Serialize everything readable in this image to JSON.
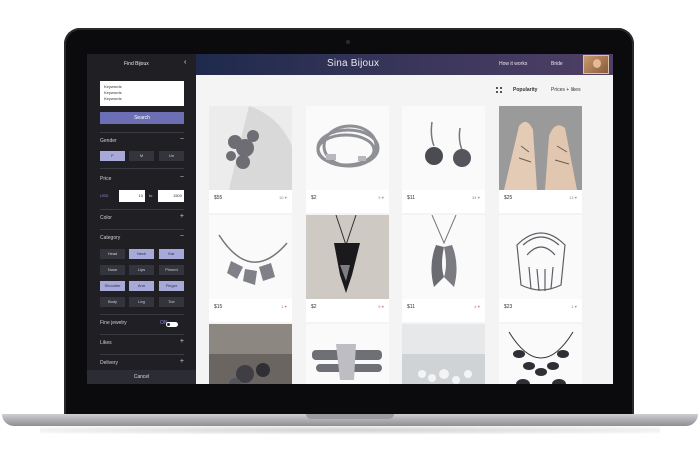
{
  "sidebar": {
    "title": "Find Bijoux",
    "close_icon": "chevron-left-icon",
    "keywords": [
      "Keywords",
      "Keywords",
      "Keywords"
    ],
    "search_label": "Search",
    "gender": {
      "label": "Gender",
      "toggle": "−",
      "options": [
        "F",
        "M",
        "Un"
      ],
      "selected": "F"
    },
    "price": {
      "label": "Price",
      "toggle": "−",
      "currency": "USD",
      "min": "10",
      "to": "to",
      "max": "1500"
    },
    "color": {
      "label": "Color",
      "toggle": "+"
    },
    "category": {
      "label": "Category",
      "toggle": "−",
      "items": [
        {
          "label": "Head",
          "selected": false
        },
        {
          "label": "Neck",
          "selected": true
        },
        {
          "label": "Ear",
          "selected": true
        },
        {
          "label": "Nose",
          "selected": false
        },
        {
          "label": "Lips",
          "selected": false
        },
        {
          "label": "Pinned",
          "selected": false
        },
        {
          "label": "Shoulder",
          "selected": true
        },
        {
          "label": "Arm",
          "selected": true
        },
        {
          "label": "Finger",
          "selected": true
        },
        {
          "label": "Body",
          "selected": false
        },
        {
          "label": "Leg",
          "selected": false
        },
        {
          "label": "Toe",
          "selected": false
        }
      ]
    },
    "fine_jewelry": {
      "label": "Fine jewelry",
      "state": "ON"
    },
    "likes": {
      "label": "Likes",
      "toggle": "+"
    },
    "delivery": {
      "label": "Delivery",
      "toggle": "+"
    },
    "footer": "Cancel"
  },
  "header": {
    "brand": "Sina Bijoux",
    "links": [
      "How it works",
      "Bride"
    ]
  },
  "sort": {
    "options": [
      "Popularity",
      "Prices + likes"
    ]
  },
  "products": [
    {
      "price": "$55",
      "likes": "10"
    },
    {
      "price": "$2",
      "likes": "9"
    },
    {
      "price": "$11",
      "likes": "34"
    },
    {
      "price": "$25",
      "likes": "13"
    },
    {
      "price": "$15",
      "likes": "1"
    },
    {
      "price": "$2",
      "likes": "9"
    },
    {
      "price": "$11",
      "likes": "4"
    },
    {
      "price": "$23",
      "likes": "1"
    },
    {
      "price": "",
      "likes": ""
    },
    {
      "price": "",
      "likes": ""
    },
    {
      "price": "",
      "likes": ""
    },
    {
      "price": "",
      "likes": ""
    }
  ],
  "heart_icon": "♥",
  "colors": {
    "sidebar": "#1f1f24",
    "accent": "#6c6fb3",
    "chip_selected": "#a7a9d9",
    "header_start": "#1e2a4c",
    "header_end": "#4f3f66"
  }
}
